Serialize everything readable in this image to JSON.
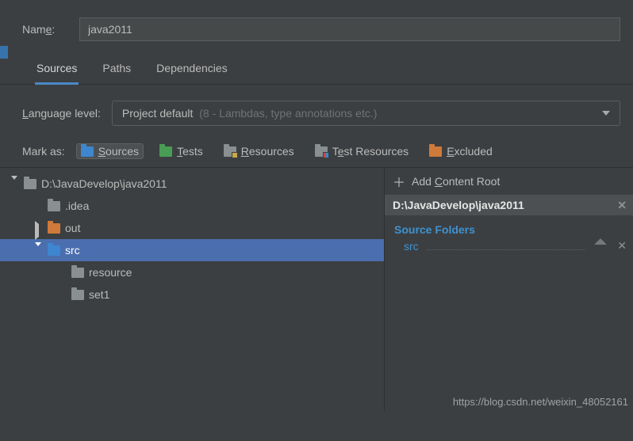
{
  "name": {
    "label": "Name:",
    "value": "java2011",
    "accel": "e"
  },
  "tabs": {
    "sources": "Sources",
    "paths": "Paths",
    "dependencies": "Dependencies"
  },
  "language": {
    "label": "Language level:",
    "accel": "L",
    "value": "Project default",
    "hint": "(8 - Lambdas, type annotations etc.)"
  },
  "mark": {
    "label": "Mark as:",
    "sources": "Sources",
    "tests": "Tests",
    "resources": "Resources",
    "testResources": "Test Resources",
    "excluded": "Excluded"
  },
  "tree": {
    "root": "D:\\JavaDevelop\\java2011",
    "idea": ".idea",
    "out": "out",
    "src": "src",
    "resource": "resource",
    "set1": "set1"
  },
  "content": {
    "add": "Add Content Root",
    "addAccel": "C",
    "path": "D:\\JavaDevelop\\java2011",
    "sourceFoldersTitle": "Source Folders",
    "srcItem": "src"
  },
  "watermark": "https://blog.csdn.net/weixin_48052161"
}
